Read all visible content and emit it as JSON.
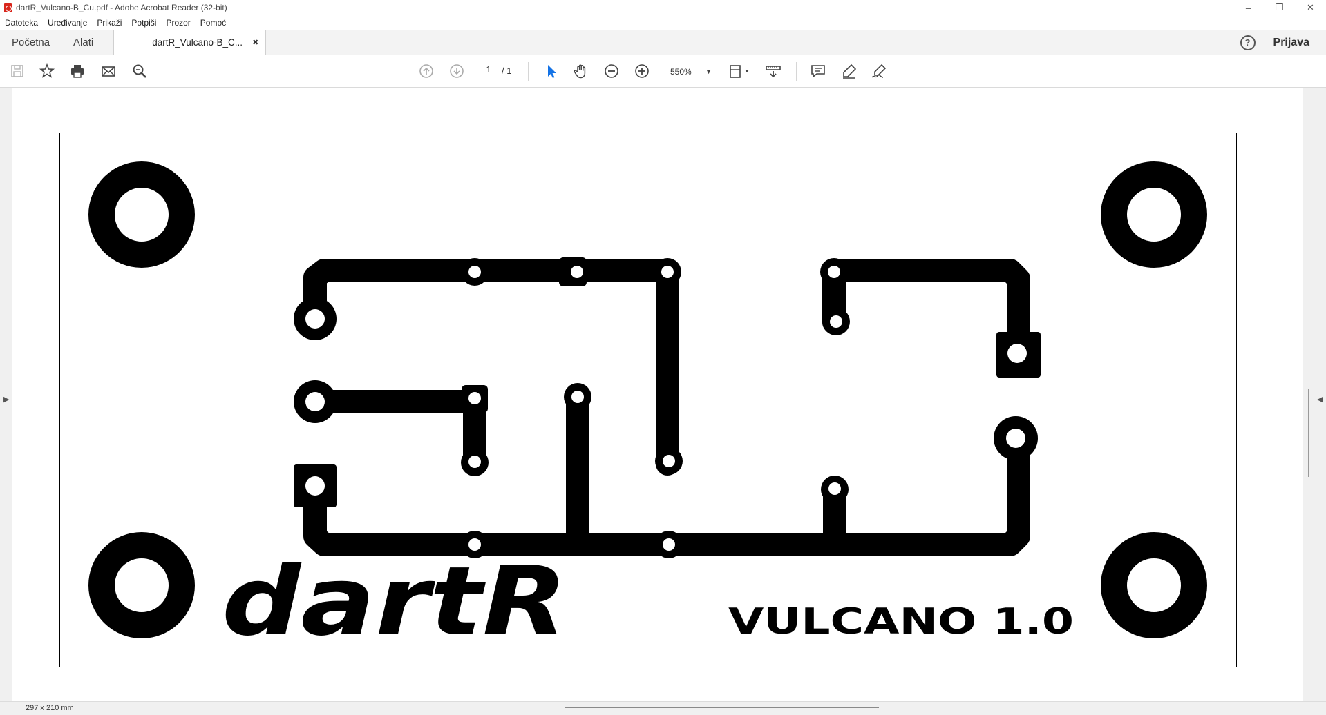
{
  "window": {
    "title": "dartR_Vulcano-B_Cu.pdf - Adobe Acrobat Reader (32-bit)",
    "controls": [
      "–",
      "❐",
      "✕"
    ]
  },
  "menu": {
    "items": [
      "Datoteka",
      "Uređivanje",
      "Prikaži",
      "Potpiši",
      "Prozor",
      "Pomoć"
    ]
  },
  "tabs": {
    "home": "Početna",
    "tools": "Alati",
    "document": "dartR_Vulcano-B_C...",
    "close_glyph": "✖"
  },
  "header_right": {
    "help_glyph": "?",
    "sign_in": "Prijava"
  },
  "toolbar": {
    "current_page": "1",
    "page_total": "/ 1",
    "zoom": "550%",
    "zoom_caret": "▼",
    "icons": [
      "save-icon",
      "star-icon",
      "print-icon",
      "mail-icon",
      "zoom-search-icon",
      "page-up-icon",
      "page-down-icon",
      "select-cursor-icon",
      "hand-icon",
      "zoom-out-icon",
      "zoom-in-icon",
      "fit-page-icon",
      "scroll-mode-icon",
      "comment-icon",
      "highlight-icon",
      "sign-icon"
    ]
  },
  "pcb": {
    "logo_text": "dartR",
    "model_text": "VULCANO 1.0"
  },
  "status": {
    "page_size": "297 x 210 mm"
  },
  "colors": {
    "accent_blue": "#1473e6",
    "pdf_red": "#d9261c",
    "copper": "#000000"
  }
}
